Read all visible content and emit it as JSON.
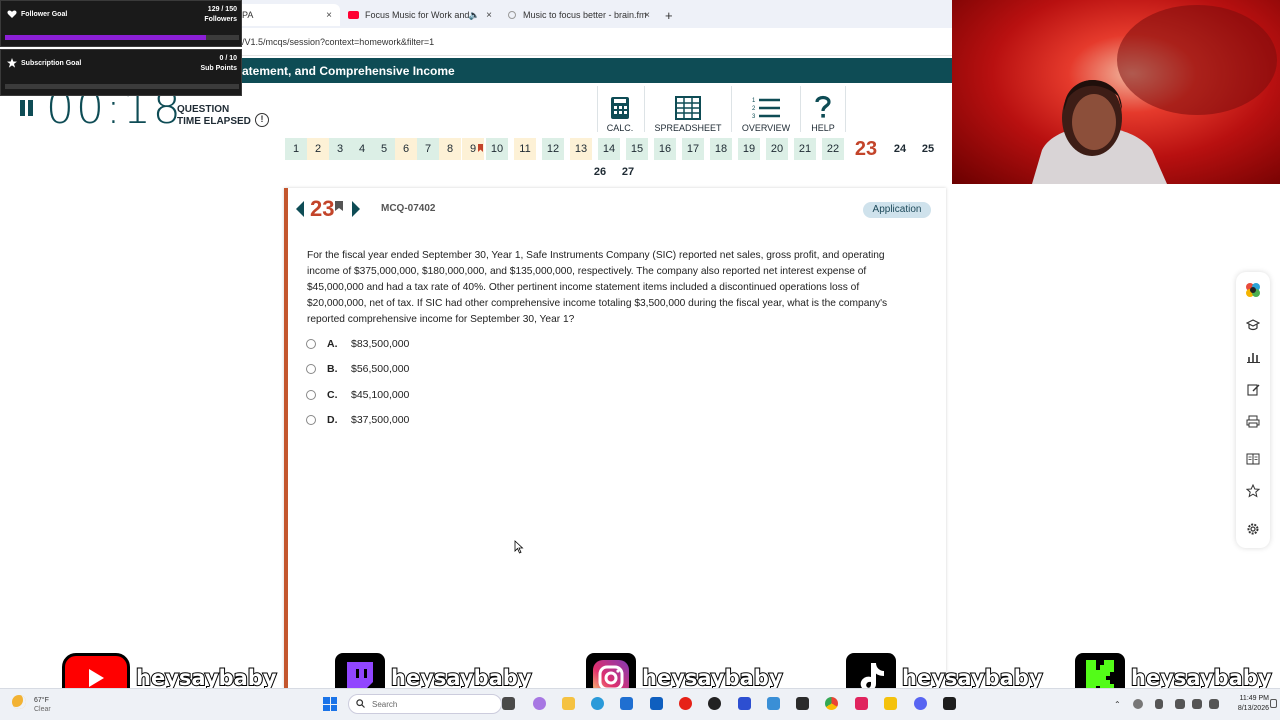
{
  "browser": {
    "tabs": [
      {
        "title": "PA",
        "close": "×"
      },
      {
        "title": "Focus Music for Work and",
        "close": "×"
      },
      {
        "title": "Music to focus better - brain.fm",
        "close": "×"
      }
    ],
    "new_tab": "+",
    "url": "/V1.5/mcqs/session?context=homework&filter=1"
  },
  "banner": {
    "title": "atement, and Comprehensive Income"
  },
  "timer": {
    "value": "00:18",
    "label_line1": "QUESTION",
    "label_line2": "TIME ELAPSED",
    "info": "!"
  },
  "tools": [
    {
      "label": "CALC.",
      "icon": "calculator-icon"
    },
    {
      "label": "SPREADSHEET",
      "icon": "spreadsheet-icon"
    },
    {
      "label": "OVERVIEW",
      "icon": "overview-icon"
    },
    {
      "label": "HELP",
      "icon": "help-icon"
    }
  ],
  "question_nav": {
    "row1": [
      "1",
      "2",
      "3",
      "4",
      "5",
      "6",
      "7",
      "8",
      "9",
      "10",
      "11",
      "12",
      "13",
      "14",
      "15",
      "16",
      "17",
      "18",
      "19",
      "20",
      "21",
      "22",
      "23",
      "24",
      "25"
    ],
    "row2": [
      "26",
      "27"
    ],
    "current": "23",
    "flagged": [
      "9"
    ]
  },
  "question": {
    "number": "23",
    "id": "MCQ-07402",
    "type_badge": "Application",
    "stem_lines": [
      "For the fiscal year ended September 30, Year 1, Safe Instruments Company (SIC) reported net sales, gross profit, and operating",
      "income of $375,000,000, $180,000,000, and $135,000,000, respectively. The company also reported net interest expense of",
      "$45,000,000 and had a tax rate of 40%. Other pertinent income statement items included a discontinued operations loss of",
      "$20,000,000, net of tax. If SIC had other comprehensive income totaling $3,500,000 during the fiscal year, what is the company's",
      "reported comprehensive income for September 30, Year 1?"
    ],
    "options": [
      {
        "letter": "A.",
        "text": "$83,500,000"
      },
      {
        "letter": "B.",
        "text": "$56,500,000"
      },
      {
        "letter": "C.",
        "text": "$45,100,000"
      },
      {
        "letter": "D.",
        "text": "$37,500,000"
      }
    ]
  },
  "sidebar_icons": [
    "app-logo-icon",
    "graduation-cap-icon",
    "bar-chart-icon",
    "edit-icon",
    "print-icon",
    "notes-icon",
    "star-icon",
    "settings-icon"
  ],
  "overlay": {
    "follower_goal": {
      "label": "Follower Goal",
      "count": "129 / 150",
      "unit": "Followers",
      "progress": 0.86
    },
    "subscription_goal": {
      "label": "Subscription Goal",
      "count": "0 / 10",
      "unit": "Sub Points",
      "progress": 0.0
    }
  },
  "socials": [
    {
      "platform": "youtube",
      "handle": "heysaybaby",
      "color": "#ff0000"
    },
    {
      "platform": "twitch",
      "handle": "heysaybaby",
      "color": "#9146ff"
    },
    {
      "platform": "instagram",
      "handle": "heysaybaby",
      "color": "#e1306c"
    },
    {
      "platform": "tiktok",
      "handle": "heysaybaby",
      "color": "#000000"
    },
    {
      "platform": "kick",
      "handle": "heysaybaby",
      "color": "#53fc18"
    }
  ],
  "taskbar": {
    "weather_temp": "67°F",
    "weather_desc": "Clear",
    "search_placeholder": "Search",
    "time": "11:49 PM",
    "date": "8/13/2026"
  }
}
